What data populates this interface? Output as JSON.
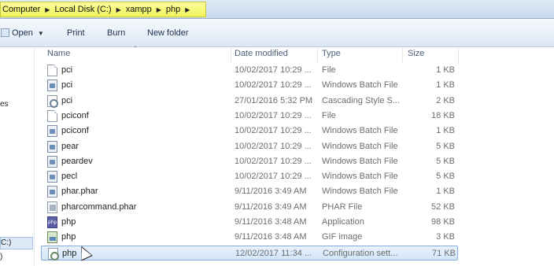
{
  "address": {
    "crumbs": [
      "Computer",
      "Local Disk (C:)",
      "xampp",
      "php"
    ]
  },
  "toolbar": {
    "open_label": "Open",
    "print_label": "Print",
    "burn_label": "Burn",
    "new_folder_label": "New folder"
  },
  "nav": {
    "item_es": "es",
    "item_c": "C:)",
    "item_paren": ")"
  },
  "columns": {
    "name": "Name",
    "date": "Date modified",
    "type": "Type",
    "size": "Size"
  },
  "files": [
    {
      "name": "pci",
      "date": "10/02/2017 10:29 ...",
      "type": "File",
      "size": "1 KB",
      "icon": "file-icon"
    },
    {
      "name": "pci",
      "date": "10/02/2017 10:29 ...",
      "type": "Windows Batch File",
      "size": "1 KB",
      "icon": "batch-file-icon"
    },
    {
      "name": "pci",
      "date": "27/01/2016 5:32 PM",
      "type": "Cascading Style S...",
      "size": "2 KB",
      "icon": "css-file-icon"
    },
    {
      "name": "pciconf",
      "date": "10/02/2017 10:29 ...",
      "type": "File",
      "size": "18 KB",
      "icon": "file-icon"
    },
    {
      "name": "pciconf",
      "date": "10/02/2017 10:29 ...",
      "type": "Windows Batch File",
      "size": "1 KB",
      "icon": "batch-file-icon"
    },
    {
      "name": "pear",
      "date": "10/02/2017 10:29 ...",
      "type": "Windows Batch File",
      "size": "5 KB",
      "icon": "batch-file-icon"
    },
    {
      "name": "peardev",
      "date": "10/02/2017 10:29 ...",
      "type": "Windows Batch File",
      "size": "5 KB",
      "icon": "batch-file-icon"
    },
    {
      "name": "pecl",
      "date": "10/02/2017 10:29 ...",
      "type": "Windows Batch File",
      "size": "5 KB",
      "icon": "batch-file-icon"
    },
    {
      "name": "phar.phar",
      "date": "9/11/2016 3:49 AM",
      "type": "Windows Batch File",
      "size": "1 KB",
      "icon": "batch-file-icon"
    },
    {
      "name": "pharcommand.phar",
      "date": "9/11/2016 3:49 AM",
      "type": "PHAR File",
      "size": "52 KB",
      "icon": "phar-file-icon"
    },
    {
      "name": "php",
      "date": "9/11/2016 3:48 AM",
      "type": "Application",
      "size": "98 KB",
      "icon": "php-application-icon"
    },
    {
      "name": "php",
      "date": "9/11/2016 3:48 AM",
      "type": "GIF image",
      "size": "3 KB",
      "icon": "gif-image-icon"
    },
    {
      "name": "php",
      "date": "12/02/2017 11:34 ...",
      "type": "Configuration sett...",
      "size": "71 KB",
      "icon": "config-file-icon",
      "selected": true
    }
  ]
}
